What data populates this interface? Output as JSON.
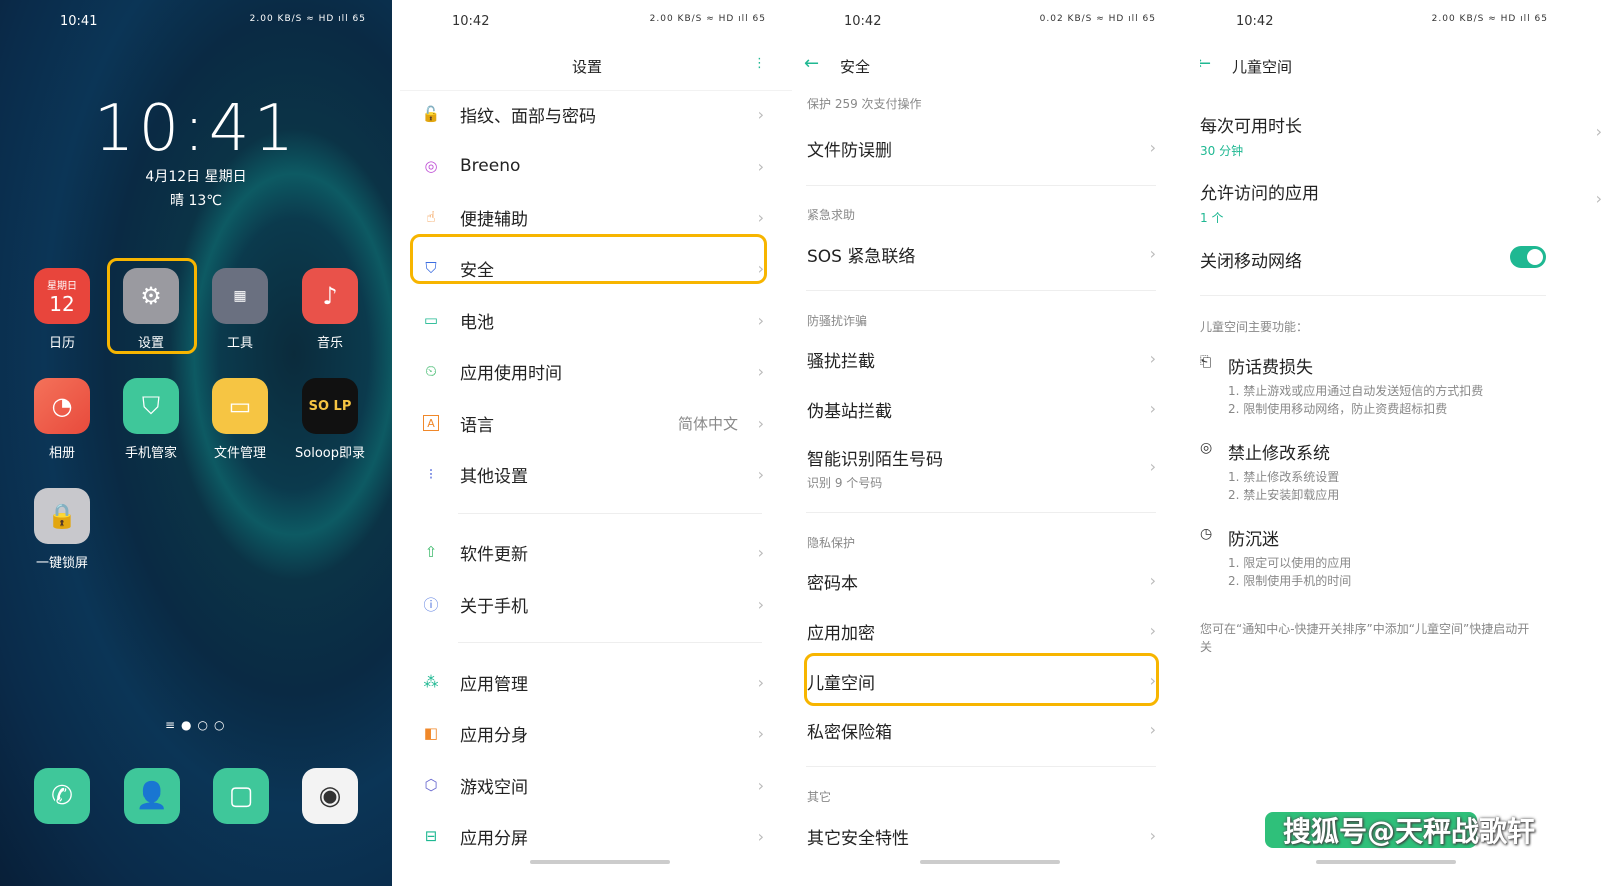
{
  "home": {
    "status_time": "10:41",
    "status_right": "2.00 KB/S ≈ HD ıll 65",
    "clock": "10:41",
    "date": "4月12日 星期日",
    "weather": "晴 13℃",
    "calendar_weekday": "星期日",
    "calendar_day": "12",
    "apps": [
      {
        "label": "日历"
      },
      {
        "label": "设置"
      },
      {
        "label": "工具"
      },
      {
        "label": "音乐"
      },
      {
        "label": "相册"
      },
      {
        "label": "手机管家"
      },
      {
        "label": "文件管理"
      },
      {
        "label": "Soloop即录"
      },
      {
        "label": "一键锁屏"
      }
    ],
    "soloop_icon_text": "SO LP"
  },
  "settings": {
    "status_time": "10:42",
    "status_right": "2.00 KB/S ≈ HD ıll 65",
    "title": "设置",
    "items": [
      {
        "label": "指纹、面部与密码",
        "icon": "lock-icon"
      },
      {
        "label": "Breeno",
        "icon": "breeno-icon"
      },
      {
        "label": "便捷辅助",
        "icon": "assist-icon"
      },
      {
        "label": "安全",
        "icon": "shield-icon"
      },
      {
        "label": "电池",
        "icon": "battery-icon"
      },
      {
        "label": "应用使用时间",
        "icon": "hourglass-icon"
      },
      {
        "label": "语言",
        "value": "简体中文",
        "icon": "language-icon"
      },
      {
        "label": "其他设置",
        "icon": "dots-icon"
      },
      {
        "label": "软件更新",
        "icon": "update-icon"
      },
      {
        "label": "关于手机",
        "icon": "info-icon"
      },
      {
        "label": "应用管理",
        "icon": "apps-icon"
      },
      {
        "label": "应用分身",
        "icon": "clone-icon"
      },
      {
        "label": "游戏空间",
        "icon": "game-icon"
      },
      {
        "label": "应用分屏",
        "icon": "split-icon"
      }
    ]
  },
  "security": {
    "status_time": "10:42",
    "status_right": "0.02 KB/S ≈ HD ıll 65",
    "title": "安全",
    "top_sub": "保护 259 次支付操作",
    "file_protect": "文件防误删",
    "cat_emergency": "紧急求助",
    "sos": "SOS 紧急联络",
    "cat_fraud": "防骚扰诈骗",
    "harass": "骚扰拦截",
    "fake_station": "伪基站拦截",
    "smart_id": "智能识别陌生号码",
    "smart_id_sub": "识别 9 个号码",
    "cat_privacy": "隐私保护",
    "password_book": "密码本",
    "app_lock": "应用加密",
    "kid_space": "儿童空间",
    "private_safe": "私密保险箱",
    "cat_other": "其它",
    "other_security": "其它安全特性"
  },
  "kids": {
    "status_time": "10:42",
    "status_right": "2.00 KB/S ≈ HD ıll 65",
    "title": "儿童空间",
    "time_limit": "每次可用时长",
    "time_limit_val": "30 分钟",
    "allowed_apps": "允许访问的应用",
    "allowed_apps_val": "1 个",
    "close_network": "关闭移动网络",
    "features_title": "儿童空间主要功能：",
    "f1_title": "防话费损失",
    "f1_l1": "1. 禁止游戏或应用通过自动发送短信的方式扣费",
    "f1_l2": "2. 限制使用移动网络，防止资费超标扣费",
    "f2_title": "禁止修改系统",
    "f2_l1": "1. 禁止修改系统设置",
    "f2_l2": "2. 禁止安装卸载应用",
    "f3_title": "防沉迷",
    "f3_l1": "1. 限定可以使用的应用",
    "f3_l2": "2. 限制使用手机的时间",
    "note": "您可在“通知中心-快捷开关排序”中添加“儿童空间”快捷启动开关",
    "watermark": "搜狐号@天秤战歌轩"
  },
  "colors": {
    "accent": "#1fb892",
    "highlight": "#f7b500"
  }
}
